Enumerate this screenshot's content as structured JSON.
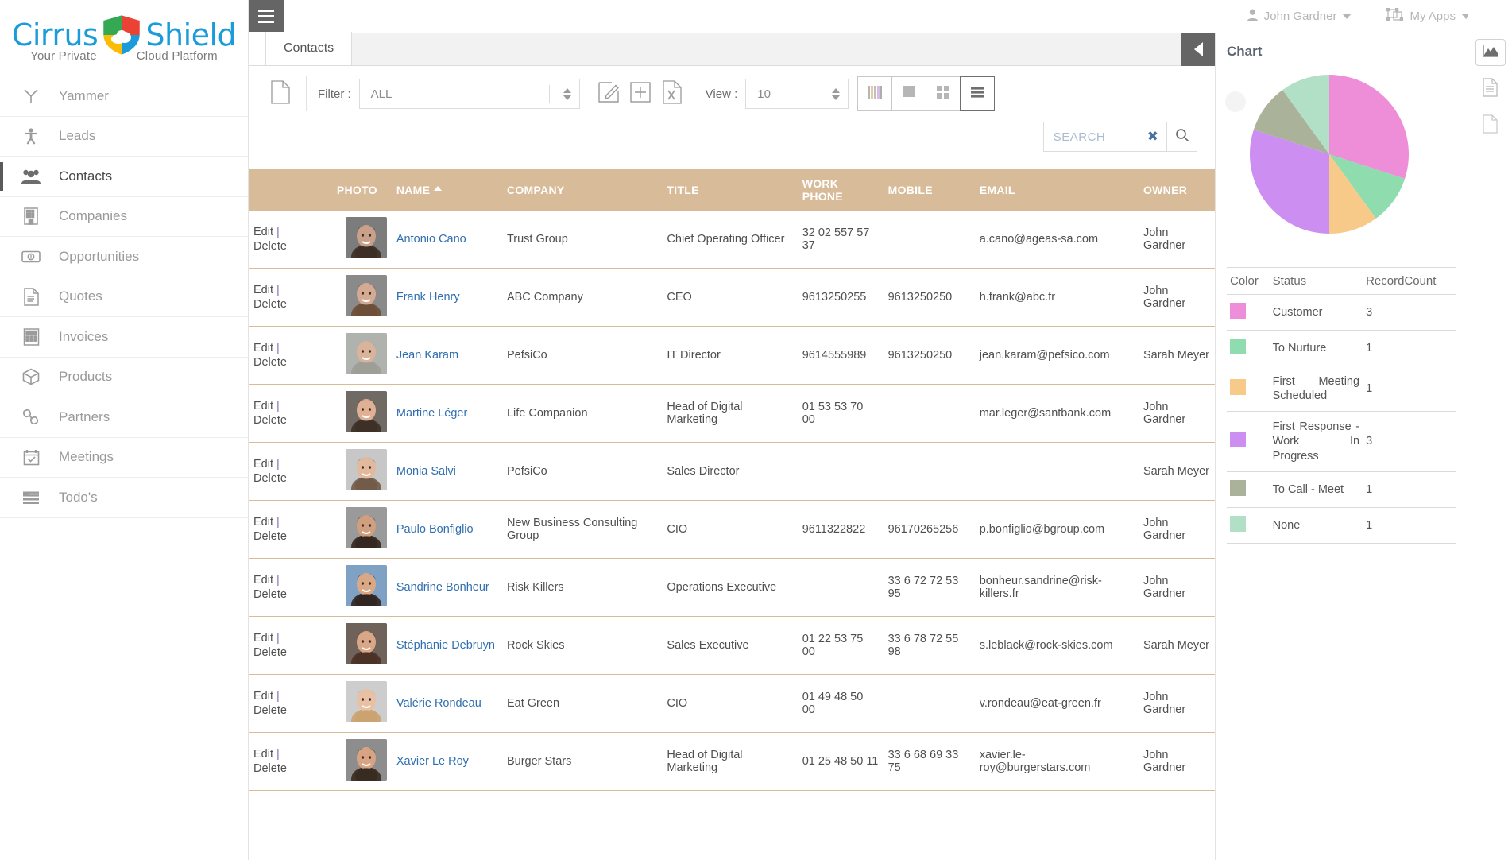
{
  "brand": {
    "name_part1": "Cirrus",
    "name_part2": "Shield",
    "tagline_left": "Your Private",
    "tagline_right": "Cloud Platform",
    "logo_icon": "shield-cloud-logo"
  },
  "topbar": {
    "menu_icon": "hamburger-menu-icon",
    "user_name": "John Gardner",
    "user_icon": "user-avatar-icon",
    "apps_label": "My Apps",
    "apps_icon": "apps-grid-icon",
    "caret_icon": "chevron-down-icon"
  },
  "sidebar": {
    "items": [
      {
        "label": "Yammer",
        "icon": "yammer-icon",
        "active": false
      },
      {
        "label": "Leads",
        "icon": "lead-person-icon",
        "active": false
      },
      {
        "label": "Contacts",
        "icon": "contacts-group-icon",
        "active": true
      },
      {
        "label": "Companies",
        "icon": "building-icon",
        "active": false
      },
      {
        "label": "Opportunities",
        "icon": "banknote-icon",
        "active": false
      },
      {
        "label": "Quotes",
        "icon": "document-lines-icon",
        "active": false
      },
      {
        "label": "Invoices",
        "icon": "calculator-icon",
        "active": false
      },
      {
        "label": "Products",
        "icon": "box-icon",
        "active": false
      },
      {
        "label": "Partners",
        "icon": "chain-link-icon",
        "active": false
      },
      {
        "label": "Meetings",
        "icon": "calendar-check-icon",
        "active": false
      },
      {
        "label": "Todo's",
        "icon": "list-bars-icon",
        "active": false
      }
    ]
  },
  "tabs": {
    "active_tab": "Contacts",
    "collapse_icon": "triangle-left-icon"
  },
  "toolbar": {
    "new_doc_icon": "blank-document-icon",
    "filter_label": "Filter :",
    "filter_value": "ALL",
    "edit_icon": "pencil-edit-icon",
    "add_icon": "plus-square-icon",
    "excel_icon": "excel-export-icon",
    "view_label": "View :",
    "view_value": "10",
    "view_modes": [
      {
        "name": "kanban-view-button",
        "icon": "colored-bars-icon",
        "active": false
      },
      {
        "name": "single-card-view-button",
        "icon": "filled-square-icon",
        "active": false
      },
      {
        "name": "tile-view-button",
        "icon": "four-squares-icon",
        "active": false
      },
      {
        "name": "list-view-button",
        "icon": "horizontal-lines-icon",
        "active": true
      }
    ]
  },
  "search": {
    "placeholder": "SEARCH",
    "value": "",
    "clear_icon": "clear-x-icon",
    "search_icon": "magnifier-icon"
  },
  "table": {
    "columns": [
      {
        "key": "actions",
        "label": "",
        "class": "c-actions"
      },
      {
        "key": "photo",
        "label": "PHOTO",
        "class": "c-photo"
      },
      {
        "key": "name",
        "label": "NAME",
        "class": "c-name",
        "sorted": "asc"
      },
      {
        "key": "company",
        "label": "COMPANY",
        "class": "c-company"
      },
      {
        "key": "title",
        "label": "TITLE",
        "class": "c-title"
      },
      {
        "key": "work_phone",
        "label": "WORK PHONE",
        "class": "c-wphone"
      },
      {
        "key": "mobile",
        "label": "MOBILE",
        "class": "c-mobile"
      },
      {
        "key": "email",
        "label": "EMAIL",
        "class": "c-email"
      },
      {
        "key": "owner",
        "label": "OWNER",
        "class": "c-owner"
      }
    ],
    "edit_label": "Edit",
    "delete_label": "Delete",
    "rows": [
      {
        "name": "Antonio Cano",
        "company": "Trust Group",
        "title": "Chief Operating Officer",
        "work_phone": "32 02 557 57 37",
        "mobile": "",
        "email": "a.cano@ageas-sa.com",
        "owner": "John Gardner",
        "avatar": "man-suit-photo",
        "skin": "#c9a089",
        "hair": "#3a2a20",
        "bg": "#7c7c7c"
      },
      {
        "name": "Frank Henry",
        "company": "ABC Company",
        "title": "CEO",
        "work_phone": "9613250255",
        "mobile": "9613250250",
        "email": "h.frank@abc.fr",
        "owner": "John Gardner",
        "avatar": "man-glasses-photo",
        "skin": "#d4ab92",
        "hair": "#6b4a33",
        "bg": "#8a8a8a"
      },
      {
        "name": "Jean Karam",
        "company": "PefsiCo",
        "title": "IT Director",
        "work_phone": "9614555989",
        "mobile": "9613250250",
        "email": "jean.karam@pefsico.com",
        "owner": "Sarah Meyer",
        "avatar": "man-gray-hair-photo",
        "skin": "#d9b49b",
        "hair": "#9c9c96",
        "bg": "#b0b2ad"
      },
      {
        "name": "Martine Léger",
        "company": "Life Companion",
        "title": "Head of Digital Marketing",
        "work_phone": "01 53 53 70 00",
        "mobile": "",
        "email": "mar.leger@santbank.com",
        "owner": "John Gardner",
        "avatar": "woman-smiling-photo",
        "skin": "#e0b094",
        "hair": "#3b2b22",
        "bg": "#6f6a63"
      },
      {
        "name": "Monia Salvi",
        "company": "PefsiCo",
        "title": "Sales Director",
        "work_phone": "",
        "mobile": "",
        "email": "",
        "owner": "Sarah Meyer",
        "avatar": "woman-blonde-photo",
        "skin": "#e3b99e",
        "hair": "#6d5440",
        "bg": "#c7c7c7"
      },
      {
        "name": "Paulo Bonfiglio",
        "company": "New Business Consulting Group",
        "title": "CIO",
        "work_phone": "9611322822",
        "mobile": "96170265256",
        "email": "p.bonfiglio@bgroup.com",
        "owner": "John Gardner",
        "avatar": "man-casual-photo",
        "skin": "#cf9f7f",
        "hair": "#2e2018",
        "bg": "#9a9a9a"
      },
      {
        "name": "Sandrine Bonheur",
        "company": "Risk Killers",
        "title": "Operations Executive",
        "work_phone": "",
        "mobile": "33 6 72 72 53 95",
        "email": "bonheur.sandrine@risk-killers.fr",
        "owner": "John Gardner",
        "avatar": "woman-outdoor-photo",
        "skin": "#dba886",
        "hair": "#2b1d16",
        "bg": "#7fa2c4"
      },
      {
        "name": "Stéphanie Debruyn",
        "company": "Rock Skies",
        "title": "Sales Executive",
        "work_phone": "01 22 53 75 00",
        "mobile": "33 6 78 72 55 98",
        "email": "s.leblack@rock-skies.com",
        "owner": "Sarah Meyer",
        "avatar": "woman-long-hair-photo",
        "skin": "#d9a788",
        "hair": "#4a2f22",
        "bg": "#6e625a"
      },
      {
        "name": "Valérie Rondeau",
        "company": "Eat Green",
        "title": "CIO",
        "work_phone": "01 49 48 50 00",
        "mobile": "",
        "email": "v.rondeau@eat-green.fr",
        "owner": "John Gardner",
        "avatar": "woman-updo-photo",
        "skin": "#e8c0a4",
        "hair": "#caa06a",
        "bg": "#cdcdcd"
      },
      {
        "name": "Xavier Le Roy",
        "company": "Burger Stars",
        "title": "Head of Digital Marketing",
        "work_phone": "01 25 48 50 11",
        "mobile": "33 6 68 69 33 75",
        "email": "xavier.le-roy@burgerstars.com",
        "owner": "John Gardner",
        "avatar": "man-short-hair-photo",
        "skin": "#d7a383",
        "hair": "#32241a",
        "bg": "#8d8d8d"
      }
    ]
  },
  "chart_panel": {
    "title": "Chart",
    "knob_icon": "chart-handle-knob"
  },
  "chart_data": {
    "type": "pie",
    "title": "Chart",
    "legend_position": "bottom",
    "categories": [
      "Customer",
      "To Nurture",
      "First Meeting Scheduled",
      "First Response - Work In Progress",
      "To Call - Meet",
      "None"
    ],
    "values": [
      3,
      1,
      1,
      3,
      1,
      1
    ],
    "colors": [
      "#ef8ed8",
      "#8fdcae",
      "#f8ca8a",
      "#cd8ef2",
      "#aab39a",
      "#b2e0c6"
    ],
    "total": 10,
    "columns": [
      "Color",
      "Status",
      "RecordCount"
    ],
    "rows": [
      {
        "color": "#ef8ed8",
        "status": "Customer",
        "count": "3"
      },
      {
        "color": "#8fdcae",
        "status": "To Nurture",
        "count": "1"
      },
      {
        "color": "#f8ca8a",
        "status": "First Meeting Scheduled",
        "count": "1"
      },
      {
        "color": "#cd8ef2",
        "status": "First Response - Work In Progress",
        "count": "3"
      },
      {
        "color": "#aab39a",
        "status": "To Call - Meet",
        "count": "1"
      },
      {
        "color": "#b2e0c6",
        "status": "None",
        "count": "1"
      }
    ]
  },
  "rail": {
    "buttons": [
      {
        "name": "chart-panel-button",
        "icon": "area-chart-icon",
        "active": true
      },
      {
        "name": "details-panel-button",
        "icon": "document-lines-icon",
        "active": false
      },
      {
        "name": "notes-panel-button",
        "icon": "blank-document-icon",
        "active": false
      }
    ]
  }
}
